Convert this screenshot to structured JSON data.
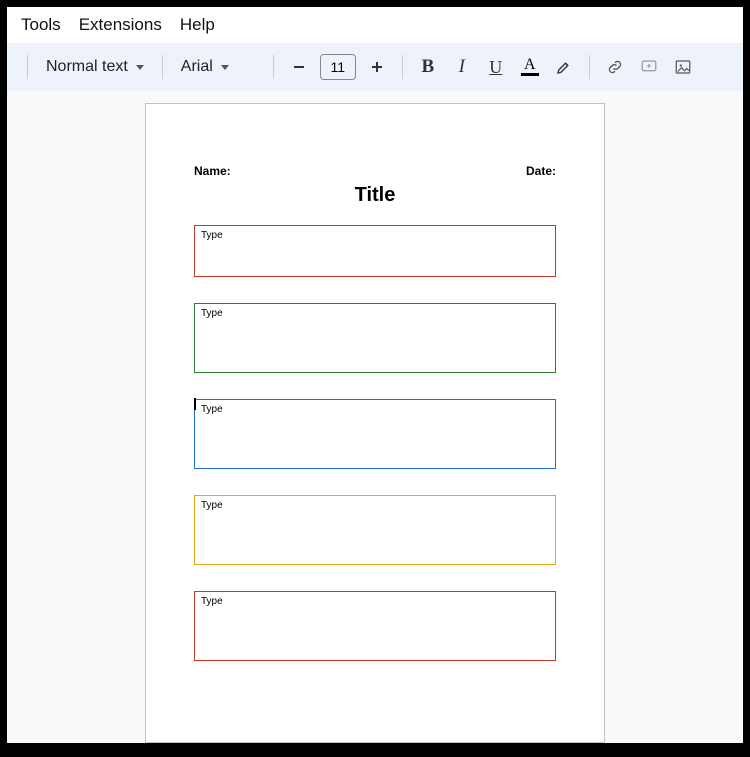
{
  "menubar": {
    "tools": "Tools",
    "extensions": "Extensions",
    "help": "Help"
  },
  "toolbar": {
    "style_label": "Normal text",
    "font_label": "Arial",
    "font_size": "11",
    "bold": "B",
    "italic": "I",
    "underline": "U",
    "textcolor_letter": "A"
  },
  "doc": {
    "name_label": "Name:",
    "date_label": "Date:",
    "title": "Title",
    "boxes": [
      {
        "placeholder": "Type",
        "color": "#c0392b"
      },
      {
        "placeholder": "Type",
        "color": "#2e7d32"
      },
      {
        "placeholder": "Type",
        "color": "#1e6fd6"
      },
      {
        "placeholder": "Type",
        "color": "#e6a817"
      },
      {
        "placeholder": "Type",
        "color": "#c0392b"
      }
    ]
  }
}
